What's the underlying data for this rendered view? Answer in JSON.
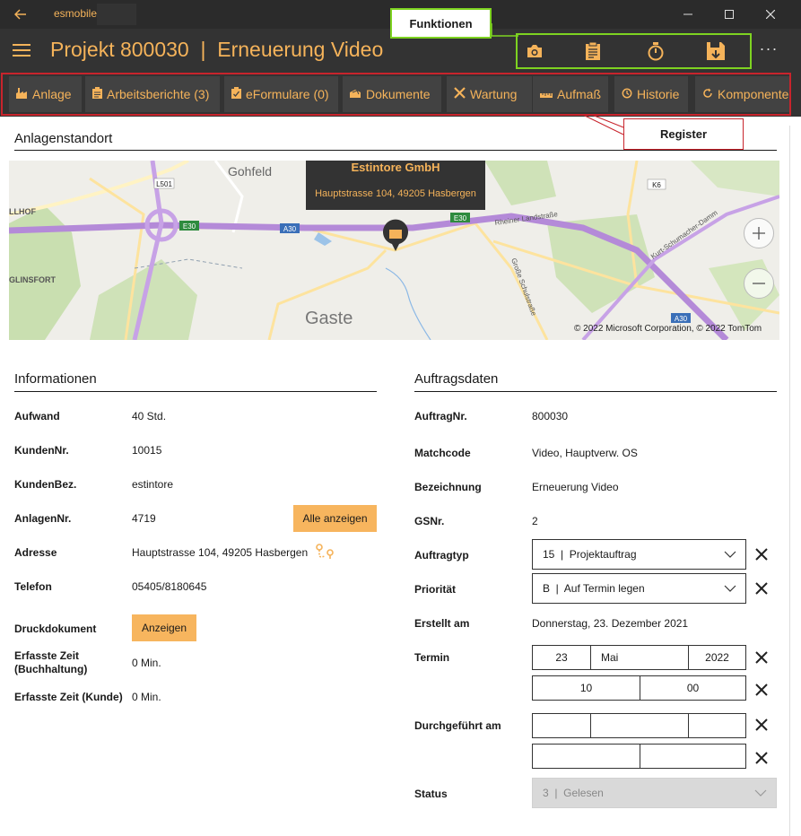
{
  "window": {
    "app_name": "esmobile"
  },
  "header": {
    "title": "Projekt 800030  |  Erneuerung Video",
    "more": "···"
  },
  "callouts": {
    "funktionen": "Funktionen",
    "register": "Register"
  },
  "tabs": [
    {
      "label": "Anlage",
      "icon": "building-icon"
    },
    {
      "label": "Arbeitsberichte (3)",
      "icon": "clipboard-icon"
    },
    {
      "label": "eFormulare (0)",
      "icon": "form-icon"
    },
    {
      "label": "Dokumente",
      "icon": "documents-icon"
    },
    {
      "label": "Wartung",
      "icon": "tools-icon"
    },
    {
      "label": "Aufmaß",
      "icon": "ruler-icon"
    },
    {
      "label": "Historie",
      "icon": "history-icon"
    },
    {
      "label": "Komponente",
      "icon": "refresh-icon"
    }
  ],
  "location": {
    "title": "Anlagenstandort",
    "popup_name": "Estintore GmbH",
    "popup_address": "Hauptstrasse 104, 49205 Hasbergen",
    "copyright": "© 2022 Microsoft Corporation, © 2022 TomTom",
    "map_labels": {
      "gohfeld": "Gohfeld",
      "gaste": "Gaste",
      "glinsfort": "GLINSFORT",
      "llhof": "LLHOF",
      "l501": "L501",
      "k6": "K6",
      "e30a": "E30",
      "e30b": "E30",
      "a30a": "A30",
      "a30b": "A30",
      "rheiner": "Rheiner Landstraße",
      "schumacher": "Kurt-Schumacher-Damm",
      "grosse": "Große Schulstraße"
    }
  },
  "info": {
    "title": "Informationen",
    "rows": {
      "aufwand": {
        "label": "Aufwand",
        "value": "40 Std."
      },
      "kundennr": {
        "label": "KundenNr.",
        "value": "10015"
      },
      "kundenbez": {
        "label": "KundenBez.",
        "value": "estintore"
      },
      "anlagennr": {
        "label": "AnlagenNr.",
        "value": "4719",
        "button": "Alle anzeigen"
      },
      "adresse": {
        "label": "Adresse",
        "value": "Hauptstrasse 104, 49205 Hasbergen"
      },
      "telefon": {
        "label": "Telefon",
        "value": "05405/8180645"
      },
      "druck": {
        "label": "Druckdokument",
        "button": "Anzeigen"
      },
      "zeit_buch": {
        "label": "Erfasste Zeit (Buchhaltung)",
        "value": "0 Min."
      },
      "zeit_kunde": {
        "label": "Erfasste Zeit (Kunde)",
        "value": "0 Min."
      }
    }
  },
  "order": {
    "title": "Auftragsdaten",
    "rows": {
      "auftragnr": {
        "label": "AuftragNr.",
        "value": "800030"
      },
      "matchcode": {
        "label": "Matchcode",
        "value": "Video, Hauptverw. OS"
      },
      "bezeichnung": {
        "label": "Bezeichnung",
        "value": "Erneuerung Video"
      },
      "gsnr": {
        "label": "GSNr.",
        "value": "2"
      },
      "auftragtyp": {
        "label": "Auftragtyp",
        "value": "15  |  Projektauftrag"
      },
      "prioritaet": {
        "label": "Priorität",
        "value": "B  |  Auf Termin legen"
      },
      "erstellt": {
        "label": "Erstellt am",
        "value": "Donnerstag, 23. Dezember 2021"
      },
      "termin": {
        "label": "Termin",
        "day": "23",
        "month": "Mai",
        "year": "2022",
        "hour": "10",
        "minute": "00"
      },
      "durchgefuehrt": {
        "label": "Durchgeführt am",
        "day": "",
        "month": "",
        "year": "",
        "hour": "",
        "minute": ""
      },
      "status": {
        "label": "Status",
        "value": "3  |  Gelesen"
      }
    }
  },
  "colors": {
    "accent": "#f5b35a",
    "header_bg": "#333333",
    "tab_bg": "#424242",
    "functions_border": "#7ed321",
    "register_border": "#c8242c"
  }
}
